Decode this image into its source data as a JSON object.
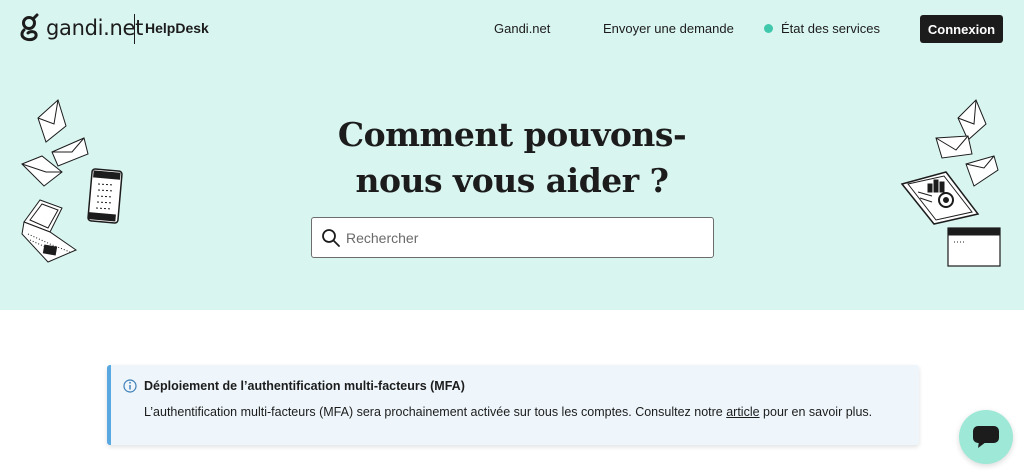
{
  "header": {
    "logo_text": "gandi.net",
    "helpdesk": "HelpDesk",
    "nav": {
      "gandi": "Gandi.net",
      "envoyer": "Envoyer une demande",
      "status": "État des services"
    },
    "login_label": "Connexion",
    "status_color": "#3fc8ac"
  },
  "hero": {
    "title_line1": "Comment pouvons-",
    "title_line2": "nous vous aider ?",
    "search_placeholder": "Rechercher",
    "background": "#d9f5f0"
  },
  "notice": {
    "title": "Déploiement de l’authentification multi-facteurs (MFA)",
    "text_before": "L’authentification multi-facteurs (MFA) sera prochainement activée sur tous les comptes. Consultez notre ",
    "link": "article",
    "text_after": " pour en savoir plus.",
    "accent": "#5aa8e0"
  },
  "icons": {
    "logo": "gandi-logo-icon",
    "search": "search-icon",
    "info": "info-icon",
    "chat": "chat-icon"
  }
}
